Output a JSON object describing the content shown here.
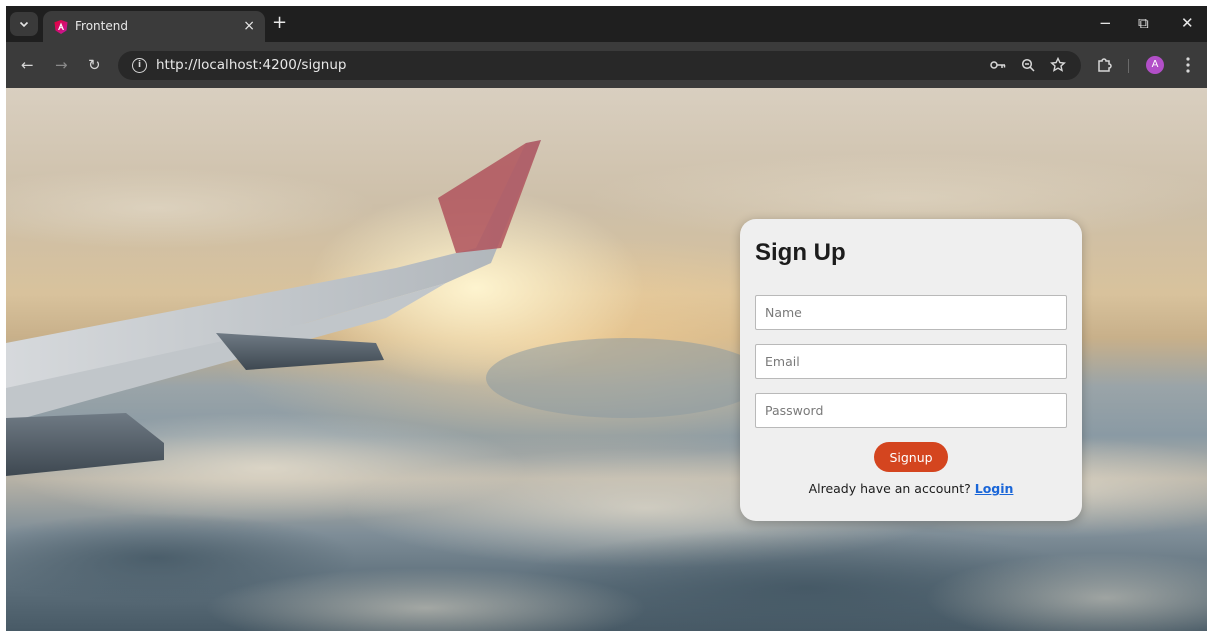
{
  "browser": {
    "tab": {
      "title": "Frontend",
      "close_glyph": "×"
    },
    "new_tab_glyph": "+",
    "window_controls": {
      "minimize": "−",
      "restore": "⧉",
      "close": "✕"
    },
    "nav": {
      "back": "←",
      "forward": "→",
      "reload": "↻"
    },
    "address": {
      "url": "http://localhost:4200/signup",
      "info_icon": "i"
    },
    "profile": {
      "initial": "A",
      "color": "#b24fc8"
    }
  },
  "signup": {
    "title": "Sign Up",
    "fields": {
      "name": {
        "placeholder": "Name",
        "value": ""
      },
      "email": {
        "placeholder": "Email",
        "value": ""
      },
      "password": {
        "placeholder": "Password",
        "value": ""
      }
    },
    "submit_label": "Signup",
    "login_prompt": "Already have an account?",
    "login_link": "Login"
  },
  "colors": {
    "accent_button": "#d4451f",
    "link": "#1a66d8",
    "card": "#efefef"
  }
}
